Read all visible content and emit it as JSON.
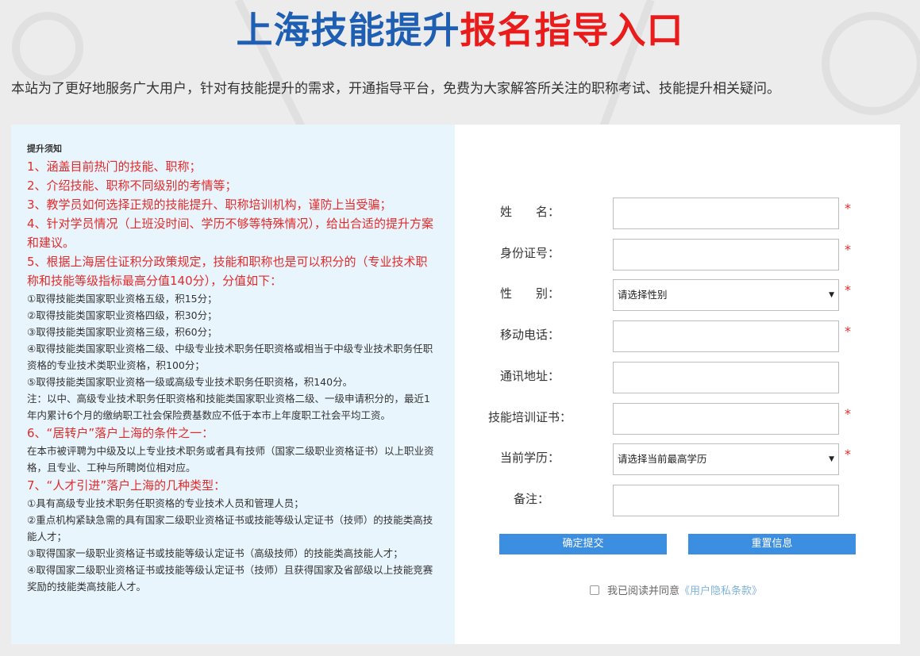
{
  "header": {
    "title_blue": "上海技能提升",
    "title_red": "报名指导入口",
    "intro": "本站为了更好地服务广大用户，针对有技能提升的需求，开通指导平台，免费为大家解答所关注的职称考试、技能提升相关疑问。"
  },
  "notes": {
    "heading": "提升须知",
    "items": [
      {
        "style": "red",
        "text": "1、涵盖目前热门的技能、职称；"
      },
      {
        "style": "red",
        "text": "2、介绍技能、职称不同级别的考情等；"
      },
      {
        "style": "red",
        "text": "3、教学员如何选择正规的技能提升、职称培训机构，谨防上当受骗；"
      },
      {
        "style": "red",
        "text": "4、针对学员情况（上班没时间、学历不够等特殊情况），给出合适的提升方案和建议。"
      },
      {
        "style": "red",
        "text": "5、根据上海居住证积分政策规定，技能和职称也是可以积分的（专业技术职称和技能等级指标最高分值140分），分值如下："
      },
      {
        "style": "black",
        "text": "①取得技能类国家职业资格五级，积15分；"
      },
      {
        "style": "black",
        "text": "②取得技能类国家职业资格四级，积30分；"
      },
      {
        "style": "black",
        "text": "③取得技能类国家职业资格三级，积60分；"
      },
      {
        "style": "black",
        "text": "④取得技能类国家职业资格二级、中级专业技术职务任职资格或相当于中级专业技术职务任职资格的专业技术类职业资格，积100分；"
      },
      {
        "style": "black",
        "text": "⑤取得技能类国家职业资格一级或高级专业技术职务任职资格，积140分。"
      },
      {
        "style": "black",
        "text": "注：以中、高级专业技术职务任职资格和技能类国家职业资格二级、一级申请积分的，最近1年内累计6个月的缴纳职工社会保险费基数应不低于本市上年度职工社会平均工资。"
      },
      {
        "style": "red",
        "text": "6、“居转户”落户上海的条件之一："
      },
      {
        "style": "black",
        "text": "在本市被评聘为中级及以上专业技术职务或者具有技师（国家二级职业资格证书）以上职业资格，且专业、工种与所聘岗位相对应。"
      },
      {
        "style": "red",
        "text": "7、“人才引进”落户上海的几种类型："
      },
      {
        "style": "black",
        "text": "①具有高级专业技术职务任职资格的专业技术人员和管理人员；"
      },
      {
        "style": "black",
        "text": "②重点机构紧缺急需的具有国家二级职业资格证书或技能等级认定证书（技师）的技能类高技能人才；"
      },
      {
        "style": "black",
        "text": "③取得国家一级职业资格证书或技能等级认定证书（高级技师）的技能类高技能人才；"
      },
      {
        "style": "black",
        "text": "④取得国家二级职业资格证书或技能等级认定证书（技师）且获得国家及省部级以上技能竞赛奖励的技能类高技能人才。"
      }
    ]
  },
  "form": {
    "name_label": "姓　　名：",
    "id_label": "身份证号：",
    "gender_label": "性　　别：",
    "gender_selected": "请选择性别",
    "phone_label": "移动电话：",
    "address_label": "通讯地址：",
    "cert_label": "技能培训证书：",
    "edu_label": "当前学历：",
    "edu_selected": "请选择当前最高学历",
    "remark_label": "备注：",
    "required_mark": "*",
    "dropdown_arrow": "▼",
    "submit_label": "确定提交",
    "reset_label": "重置信息",
    "agree_text": "我已阅读并同意",
    "agree_link": "《用户隐私条款》"
  },
  "colors": {
    "title_blue": "#1f5fb3",
    "title_red": "#ea1b1b",
    "note_red": "#e52a2a",
    "button_blue": "#3c8ee0",
    "left_panel_bg": "#e9f5fd"
  }
}
